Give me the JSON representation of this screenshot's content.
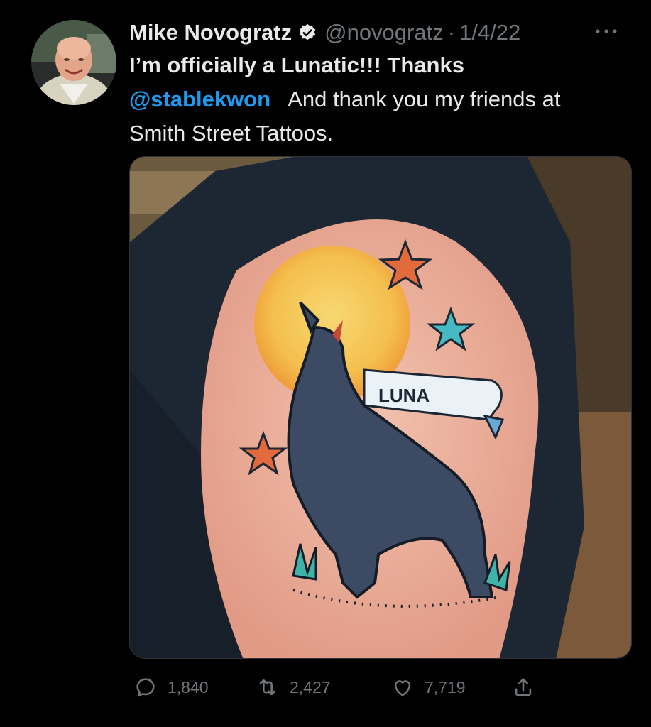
{
  "tweet": {
    "author": {
      "display_name": "Mike Novogratz",
      "handle": "@novogratz",
      "separator": "·",
      "date": "1/4/22",
      "verified": true,
      "avatar_icon": "profile-photo"
    },
    "text": {
      "line1": "I’m officially a Lunatic!!!  Thanks",
      "mention": "@stablekwon",
      "line2_rest": "   And thank you my friends at",
      "line3": "Smith Street Tattoos."
    },
    "media": {
      "banner_text": "LUNA"
    },
    "actions": {
      "reply_count": "1,840",
      "retweet_count": "2,427",
      "like_count": "7,719"
    }
  },
  "colors": {
    "background": "#000000",
    "text_primary": "#e7e9ea",
    "text_secondary": "#71767b",
    "accent": "#1d9bf0"
  },
  "icons": [
    "verified-badge-icon",
    "more-icon",
    "reply-icon",
    "retweet-icon",
    "like-icon",
    "share-icon"
  ]
}
